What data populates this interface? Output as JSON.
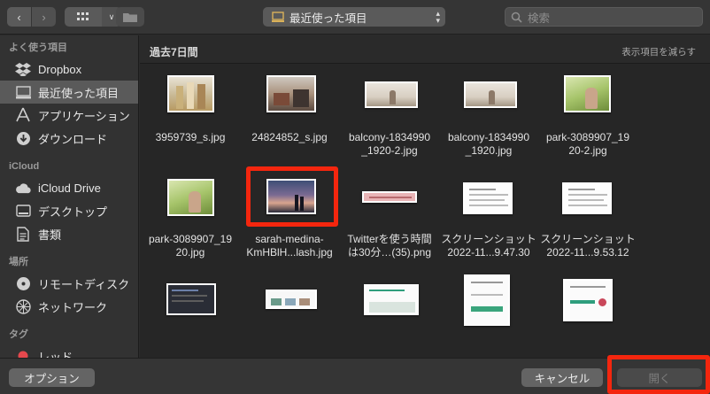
{
  "toolbar": {
    "location_label": "最近使った項目",
    "search_placeholder": "検索"
  },
  "sidebar": {
    "sections": [
      {
        "title": "よく使う項目",
        "items": [
          {
            "label": "Dropbox",
            "icon": "dropbox-icon"
          },
          {
            "label": "最近使った項目",
            "icon": "recents-icon",
            "selected": true
          },
          {
            "label": "アプリケーション",
            "icon": "applications-icon"
          },
          {
            "label": "ダウンロード",
            "icon": "downloads-icon"
          }
        ]
      },
      {
        "title": "iCloud",
        "items": [
          {
            "label": "iCloud Drive",
            "icon": "icloud-icon"
          },
          {
            "label": "デスクトップ",
            "icon": "desktop-icon"
          },
          {
            "label": "書類",
            "icon": "documents-icon"
          }
        ]
      },
      {
        "title": "場所",
        "items": [
          {
            "label": "リモートディスク",
            "icon": "remote-disc-icon"
          },
          {
            "label": "ネットワーク",
            "icon": "network-icon"
          }
        ]
      },
      {
        "title": "タグ",
        "items": [
          {
            "label": "レッド",
            "icon": "red-tag-icon",
            "color": "#e5484d"
          }
        ]
      }
    ]
  },
  "content": {
    "section_title": "過去7日間",
    "show_less": "表示項目を減らす",
    "files": [
      {
        "line1": "3959739_s.jpg",
        "line2": ""
      },
      {
        "line1": "24824852_s.jpg",
        "line2": ""
      },
      {
        "line1": "balcony-1834990",
        "line2": "_1920-2.jpg"
      },
      {
        "line1": "balcony-1834990",
        "line2": "_1920.jpg"
      },
      {
        "line1": "park-3089907_19",
        "line2": "20-2.jpg"
      },
      {
        "line1": "park-3089907_19",
        "line2": "20.jpg"
      },
      {
        "line1": "sarah-medina-",
        "line2": "KmHBlH...lash.jpg"
      },
      {
        "line1": "Twitterを使う時間",
        "line2": "は30分…(35).png"
      },
      {
        "line1": "スクリーンショット",
        "line2": "2022-11...9.47.30"
      },
      {
        "line1": "スクリーンショット",
        "line2": "2022-11...9.53.12"
      },
      {
        "line1": "",
        "line2": ""
      },
      {
        "line1": "",
        "line2": ""
      },
      {
        "line1": "",
        "line2": ""
      },
      {
        "line1": "",
        "line2": ""
      },
      {
        "line1": "",
        "line2": ""
      }
    ]
  },
  "bottom": {
    "options_label": "オプション",
    "cancel_label": "キャンセル",
    "open_label": "開く"
  },
  "colors": {
    "highlight": "#f4260e",
    "selection": "#5a5a5a"
  }
}
